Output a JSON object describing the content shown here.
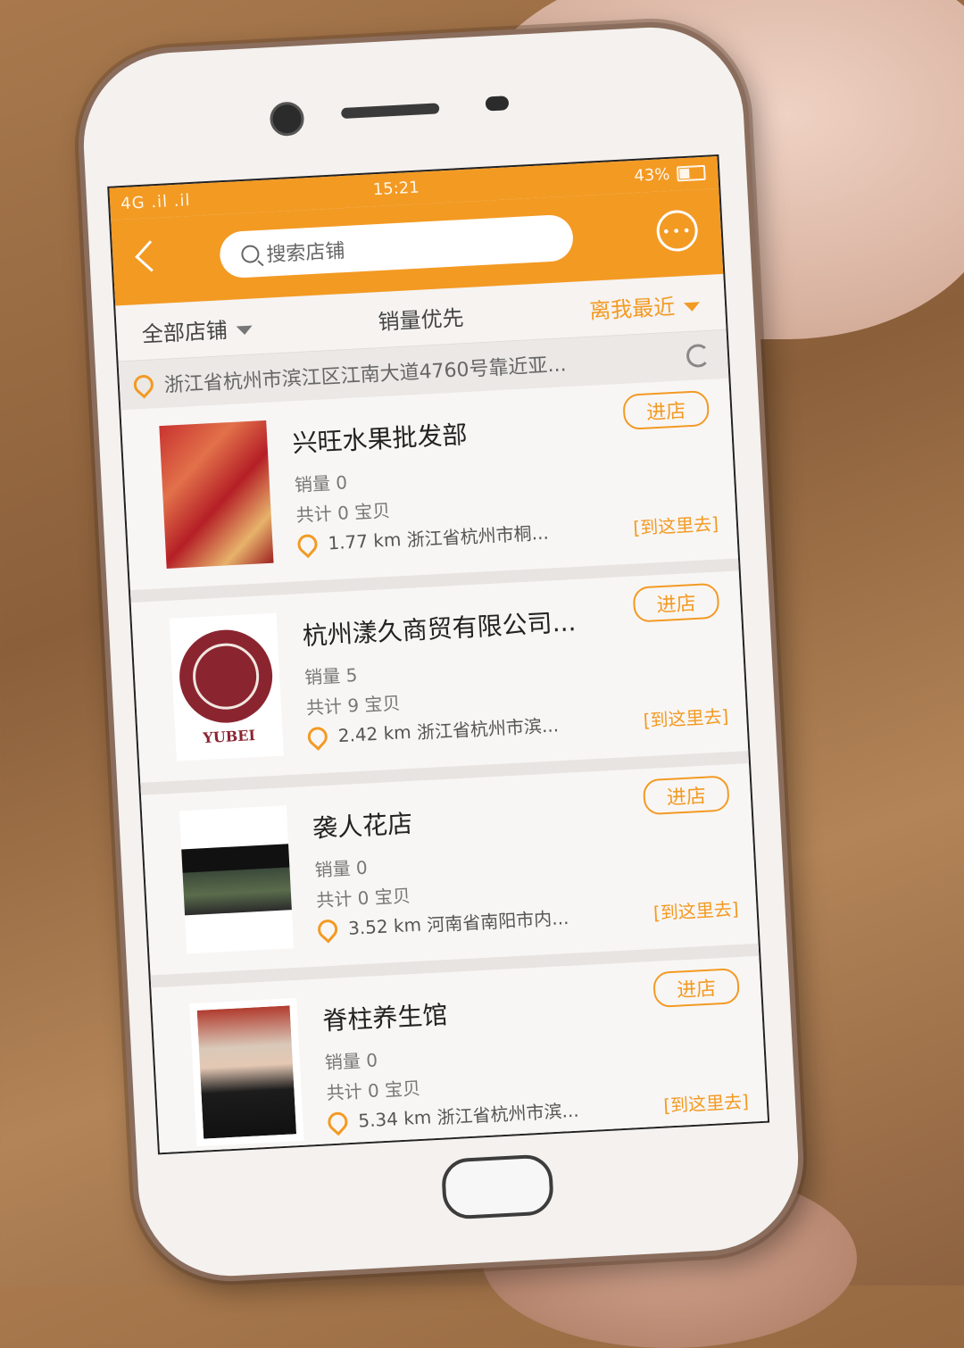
{
  "status_bar": {
    "signal": "4G .il .il",
    "time": "15:21",
    "battery": "43%"
  },
  "header": {
    "search_placeholder": "搜索店铺"
  },
  "filters": {
    "all": "全部店铺",
    "sales": "销量优先",
    "nearest": "离我最近"
  },
  "location": {
    "text": "浙江省杭州市滨江区江南大道4760号靠近亚..."
  },
  "stores": [
    {
      "name": "兴旺水果批发部",
      "sales": "销量 0",
      "total": "共计 0 宝贝",
      "distance": "1.77 km",
      "address": "浙江省杭州市桐...",
      "enter": "进店",
      "nav": "[到这里去]"
    },
    {
      "name": "杭州漾久商贸有限公司...",
      "sales": "销量 5",
      "total": "共计 9 宝贝",
      "distance": "2.42 km",
      "address": "浙江省杭州市滨...",
      "enter": "进店",
      "nav": "[到这里去]",
      "logo_text": "YUBEI"
    },
    {
      "name": "袭人花店",
      "sales": "销量 0",
      "total": "共计 0 宝贝",
      "distance": "3.52 km",
      "address": "河南省南阳市内...",
      "enter": "进店",
      "nav": "[到这里去]"
    },
    {
      "name": "脊柱养生馆",
      "sales": "销量 0",
      "total": "共计 0 宝贝",
      "distance": "5.34 km",
      "address": "浙江省杭州市滨...",
      "enter": "进店",
      "nav": "[到这里去]"
    }
  ],
  "colors": {
    "accent": "#f39a23"
  },
  "icons": [
    "back-icon",
    "search-icon",
    "chat-icon",
    "location-pin-icon",
    "refresh-icon",
    "caret-down-icon"
  ]
}
